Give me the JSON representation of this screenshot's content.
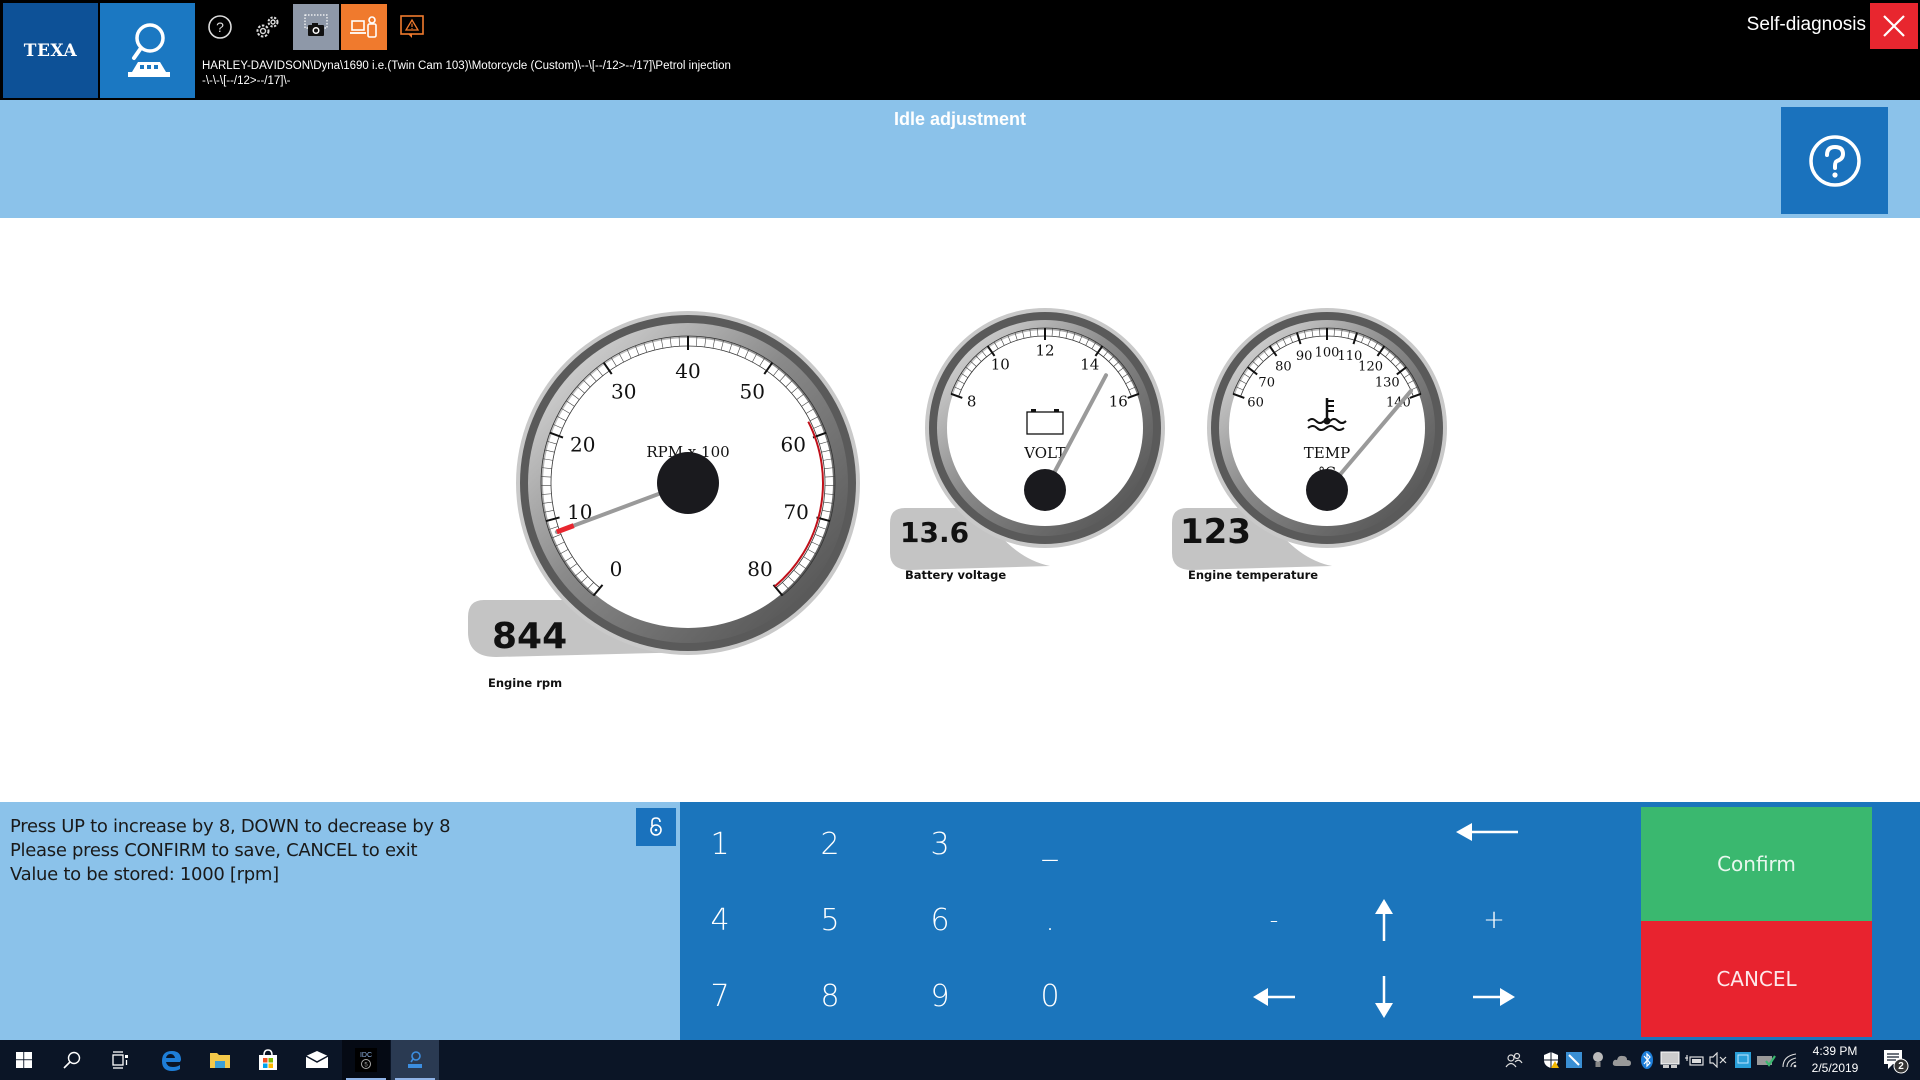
{
  "topbar": {
    "logo_text": "TEXA",
    "vehicle_path_line1": "HARLEY-DAVIDSON\\Dyna\\1690 i.e.(Twin Cam 103)\\Motorcycle (Custom)\\--\\[--/12>--/17]\\Petrol injection",
    "vehicle_path_line2": "-\\-\\-\\[--/12>--/17]\\-",
    "mode_label": "Self-diagnosis",
    "icons": [
      "help-icon",
      "settings-gears-icon",
      "screenshot-camera-icon",
      "remote-assistance-icon",
      "alert-icon"
    ]
  },
  "header": {
    "title": "Idle adjustment"
  },
  "gauges": [
    {
      "id": "rpm",
      "unit_label": "RPM x 100",
      "scale_min": 0,
      "scale_max": 80,
      "major_ticks": [
        "0",
        "10",
        "20",
        "30",
        "40",
        "50",
        "60",
        "70",
        "80"
      ],
      "redline_from": 58,
      "value": 844,
      "needle_value": 8.44,
      "readout": "844",
      "label": "Engine rpm"
    },
    {
      "id": "volt",
      "unit_label": "VOLT",
      "scale_min": 8,
      "scale_max": 16,
      "major_ticks": [
        "8",
        "10",
        "12",
        "14",
        "16"
      ],
      "value": 13.6,
      "needle_value": 13.6,
      "readout": "13.6",
      "label": "Battery voltage"
    },
    {
      "id": "temp",
      "unit_label": "TEMP",
      "unit_sub": "°C",
      "scale_min": 60,
      "scale_max": 140,
      "major_ticks": [
        "60",
        "70",
        "80",
        "90",
        "100",
        "110",
        "120",
        "130",
        "140"
      ],
      "value": 123,
      "needle_value": 123,
      "readout": "123",
      "label": "Engine temperature"
    }
  ],
  "message": {
    "line1": "Press UP to increase by 8, DOWN to decrease by 8",
    "line2": "Please press CONFIRM to save, CANCEL to exit",
    "line3": "Value to be stored: 1000 [rpm]"
  },
  "keypad": {
    "keys": [
      "1",
      "2",
      "3",
      "_",
      "4",
      "5",
      "6",
      ".",
      "7",
      "8",
      "9",
      "0"
    ],
    "minus": "-",
    "plus": "+"
  },
  "actions": {
    "confirm": "Confirm",
    "cancel": "CANCEL"
  },
  "taskbar": {
    "time": "4:39 PM",
    "date": "2/5/2019",
    "notification_count": "2"
  },
  "colors": {
    "brand_blue": "#0d5197",
    "accent_blue": "#1b75bc",
    "light_blue": "#8bc2ea",
    "confirm_green": "#3ab86f",
    "cancel_red": "#e8232f",
    "orange": "#f07a2d"
  }
}
